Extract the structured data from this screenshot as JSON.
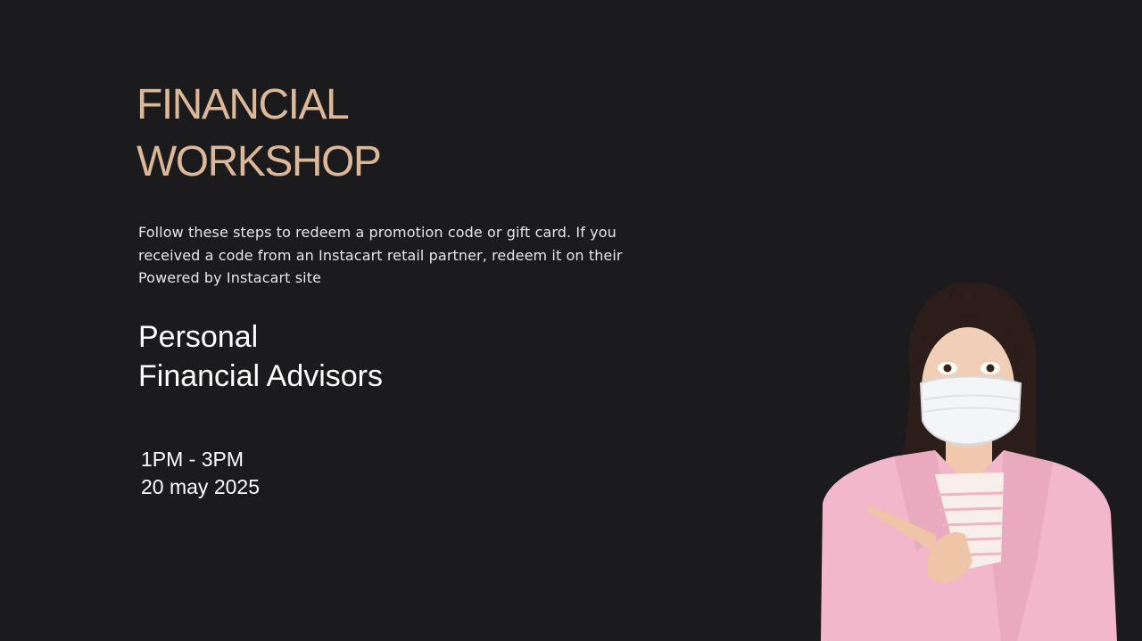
{
  "slide": {
    "title_lines": [
      "FINANCIAL",
      "WORKSHOP"
    ],
    "description": "Follow these steps to redeem a promotion code or gift card. If you received a code from an Instacart retail partner, redeem it on their Powered by Instacart site",
    "subtitle_lines": [
      "Personal",
      "Financial Advisors"
    ],
    "time": "1PM - 3PM",
    "date": "20 may 2025"
  },
  "colors": {
    "background": "#1b1b1d",
    "title": "#dcb898",
    "text": "#ffffff",
    "jacket": "#f2b7cb",
    "mask": "#f3f5f7"
  },
  "image": {
    "subject": "woman-in-pink-blazer-wearing-face-mask-pointing-icon"
  }
}
